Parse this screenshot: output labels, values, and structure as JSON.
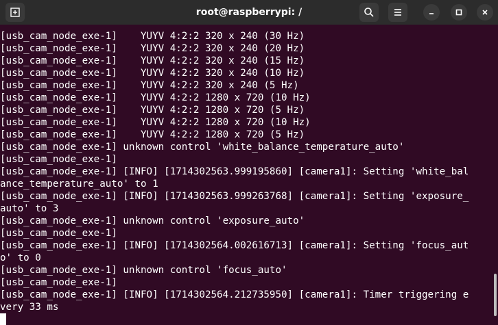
{
  "window": {
    "title": "root@raspberrypi: /"
  },
  "icons": {
    "new_tab": "new-tab-icon",
    "search": "search-icon",
    "menu": "hamburger-menu-icon",
    "minimize": "minimize-icon",
    "maximize": "maximize-icon",
    "close": "close-icon"
  },
  "colors": {
    "terminal_bg": "#300a24",
    "titlebar_bg": "#2c2c2c",
    "text": "#ffffff"
  },
  "terminal": {
    "lines": [
      "[usb_cam_node_exe-1]    YUYV 4:2:2 320 x 240 (30 Hz)",
      "[usb_cam_node_exe-1]    YUYV 4:2:2 320 x 240 (20 Hz)",
      "[usb_cam_node_exe-1]    YUYV 4:2:2 320 x 240 (15 Hz)",
      "[usb_cam_node_exe-1]    YUYV 4:2:2 320 x 240 (10 Hz)",
      "[usb_cam_node_exe-1]    YUYV 4:2:2 320 x 240 (5 Hz)",
      "[usb_cam_node_exe-1]    YUYV 4:2:2 1280 x 720 (10 Hz)",
      "[usb_cam_node_exe-1]    YUYV 4:2:2 1280 x 720 (5 Hz)",
      "[usb_cam_node_exe-1]    YUYV 4:2:2 1280 x 720 (10 Hz)",
      "[usb_cam_node_exe-1]    YUYV 4:2:2 1280 x 720 (5 Hz)",
      "[usb_cam_node_exe-1] unknown control 'white_balance_temperature_auto'",
      "[usb_cam_node_exe-1]",
      "[usb_cam_node_exe-1] [INFO] [1714302563.999195860] [camera1]: Setting 'white_bal",
      "ance_temperature_auto' to 1",
      "[usb_cam_node_exe-1] [INFO] [1714302563.999263768] [camera1]: Setting 'exposure_",
      "auto' to 3",
      "[usb_cam_node_exe-1] unknown control 'exposure_auto'",
      "[usb_cam_node_exe-1]",
      "[usb_cam_node_exe-1] [INFO] [1714302564.002616713] [camera1]: Setting 'focus_aut",
      "o' to 0",
      "[usb_cam_node_exe-1] unknown control 'focus_auto'",
      "[usb_cam_node_exe-1]",
      "[usb_cam_node_exe-1] [INFO] [1714302564.212735950] [camera1]: Timer triggering e",
      "very 33 ms"
    ]
  }
}
